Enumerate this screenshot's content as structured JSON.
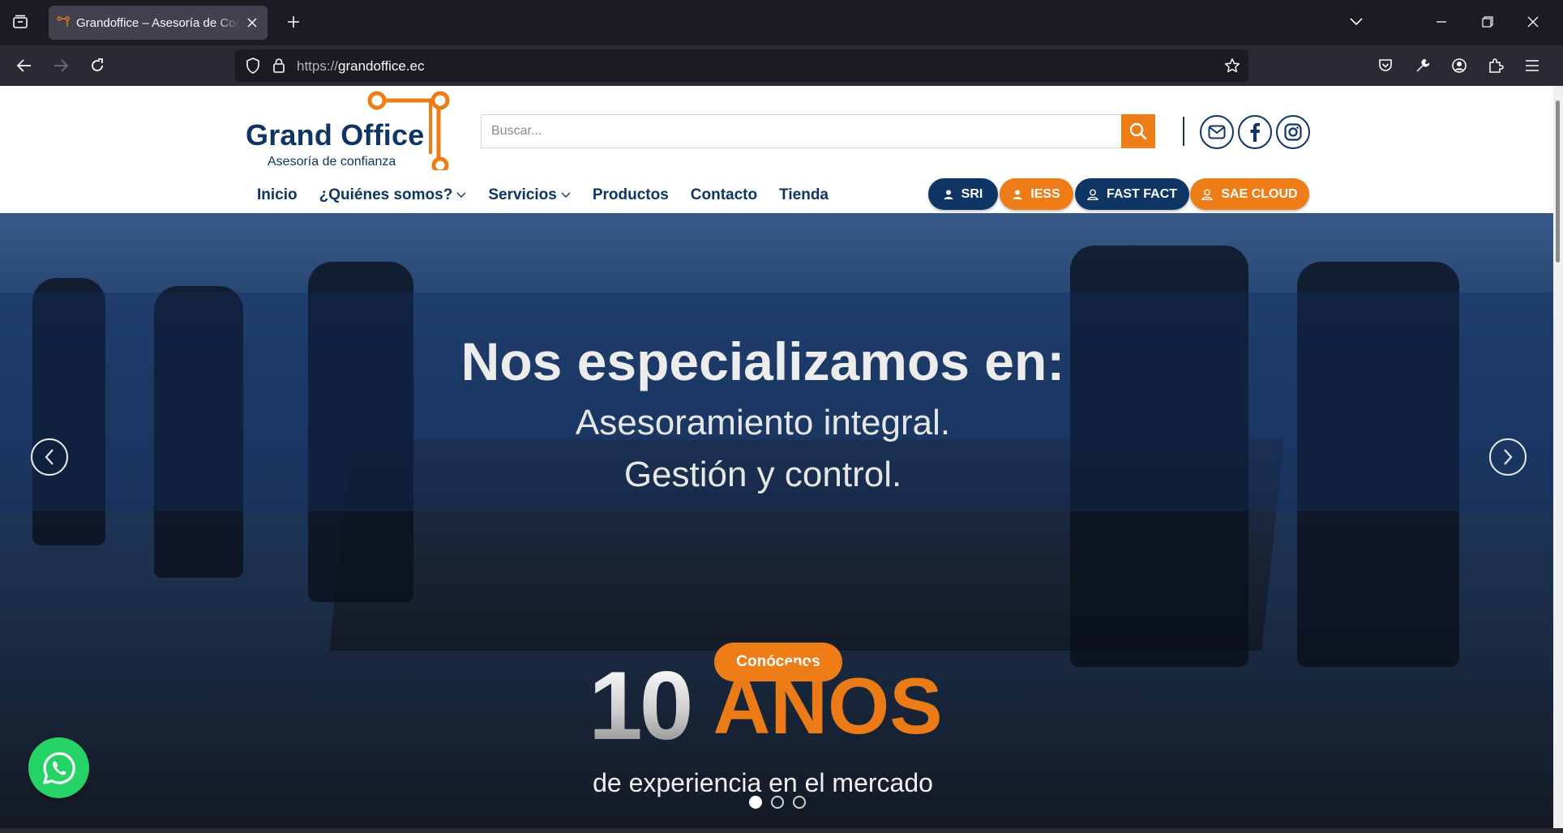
{
  "browser": {
    "tab_title": "Grandoffice – Asesoría de Confianza",
    "url_protocol": "https://",
    "url_host": "grandoffice.ec"
  },
  "site": {
    "brand": "Grand Office",
    "tagline": "Asesoría de confianza",
    "search_placeholder": "Buscar...",
    "nav": [
      {
        "label": "Inicio"
      },
      {
        "label": "¿Quiénes somos?"
      },
      {
        "label": "Servicios"
      },
      {
        "label": "Productos"
      },
      {
        "label": "Contacto"
      },
      {
        "label": "Tienda"
      }
    ],
    "quick_links": [
      {
        "label": "SRI"
      },
      {
        "label": "IESS"
      },
      {
        "label": "FAST FACT"
      },
      {
        "label": "SAE CLOUD"
      }
    ],
    "colors": {
      "navy": "#0f3564",
      "orange": "#ee7d17"
    }
  },
  "hero": {
    "headline": "Nos especializamos en:",
    "line1": "Asesoramiento integral.",
    "line2": "Gestión y control.",
    "cta": "Conócenos",
    "years_number": "10",
    "years_word": "AÑOS",
    "experience": "de experiencia en el mercado",
    "slides": 3,
    "active_slide": 1
  }
}
